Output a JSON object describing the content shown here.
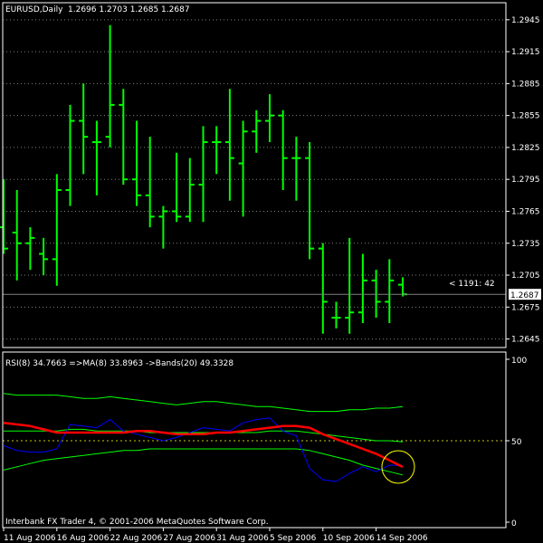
{
  "header": {
    "symbol": "EURUSD,Daily",
    "ohlc": "1.2696 1.2703 1.2685 1.2687"
  },
  "price_label": "1.2687",
  "order_label": "< 1191: 42",
  "indicator_header": "RSI(8) 34.7663   =>MA(8) 33.8963   ->Bands(20) 49.3328",
  "footer": "Interbank FX Trader 4, © 2001-2006 MetaQuotes Software Corp.",
  "colors": {
    "background": "#000000",
    "frame": "#FFFFFF",
    "grid": "#808080",
    "bars": "#00FF00",
    "rsi": "#0000FF",
    "ma": "#FF0000",
    "bands": "#00FF00",
    "level_line": "#C8C800",
    "highlight_circle": "#FFFF00",
    "price_label_bg": "#FFFFFF"
  },
  "chart_data": [
    {
      "type": "ohlc",
      "title": "EURUSD,Daily",
      "x_tick_labels": [
        "11 Aug 2006",
        "16 Aug 2006",
        "22 Aug 2006",
        "27 Aug 2006",
        "31 Aug 2006",
        "5 Sep 2006",
        "10 Sep 2006",
        "14 Sep 2006"
      ],
      "y_tick_labels": [
        "1.2945",
        "1.2915",
        "1.2885",
        "1.2855",
        "1.2825",
        "1.2795",
        "1.2765",
        "1.2735",
        "1.2705",
        "1.2675",
        "1.2645"
      ],
      "ylim": [
        1.2637,
        1.2961
      ],
      "current_price": 1.2687,
      "grid": true,
      "bars": [
        {
          "o": 1.275,
          "h": 1.2795,
          "l": 1.2725,
          "c": 1.273
        },
        {
          "o": 1.2745,
          "h": 1.2785,
          "l": 1.27,
          "c": 1.2735
        },
        {
          "o": 1.2735,
          "h": 1.275,
          "l": 1.271,
          "c": 1.274
        },
        {
          "o": 1.2725,
          "h": 1.274,
          "l": 1.2705,
          "c": 1.272
        },
        {
          "o": 1.272,
          "h": 1.28,
          "l": 1.2695,
          "c": 1.2785
        },
        {
          "o": 1.2785,
          "h": 1.2865,
          "l": 1.277,
          "c": 1.285
        },
        {
          "o": 1.285,
          "h": 1.2885,
          "l": 1.28,
          "c": 1.2835
        },
        {
          "o": 1.283,
          "h": 1.285,
          "l": 1.278,
          "c": 1.283
        },
        {
          "o": 1.2835,
          "h": 1.294,
          "l": 1.2825,
          "c": 1.2865
        },
        {
          "o": 1.2865,
          "h": 1.288,
          "l": 1.279,
          "c": 1.2795
        },
        {
          "o": 1.2795,
          "h": 1.285,
          "l": 1.277,
          "c": 1.278
        },
        {
          "o": 1.278,
          "h": 1.2835,
          "l": 1.275,
          "c": 1.276
        },
        {
          "o": 1.276,
          "h": 1.277,
          "l": 1.273,
          "c": 1.2765
        },
        {
          "o": 1.2765,
          "h": 1.282,
          "l": 1.2755,
          "c": 1.276
        },
        {
          "o": 1.276,
          "h": 1.2815,
          "l": 1.2755,
          "c": 1.279
        },
        {
          "o": 1.279,
          "h": 1.2845,
          "l": 1.2755,
          "c": 1.283
        },
        {
          "o": 1.283,
          "h": 1.2845,
          "l": 1.28,
          "c": 1.283
        },
        {
          "o": 1.283,
          "h": 1.288,
          "l": 1.2775,
          "c": 1.2815
        },
        {
          "o": 1.281,
          "h": 1.285,
          "l": 1.276,
          "c": 1.284
        },
        {
          "o": 1.284,
          "h": 1.286,
          "l": 1.282,
          "c": 1.285
        },
        {
          "o": 1.285,
          "h": 1.2875,
          "l": 1.283,
          "c": 1.2855
        },
        {
          "o": 1.2855,
          "h": 1.286,
          "l": 1.2785,
          "c": 1.2815
        },
        {
          "o": 1.2815,
          "h": 1.2835,
          "l": 1.2775,
          "c": 1.2815
        },
        {
          "o": 1.2815,
          "h": 1.283,
          "l": 1.272,
          "c": 1.273
        },
        {
          "o": 1.273,
          "h": 1.2735,
          "l": 1.265,
          "c": 1.268
        },
        {
          "o": 1.2665,
          "h": 1.268,
          "l": 1.2655,
          "c": 1.2665
        },
        {
          "o": 1.2665,
          "h": 1.274,
          "l": 1.265,
          "c": 1.267
        },
        {
          "o": 1.267,
          "h": 1.2725,
          "l": 1.266,
          "c": 1.27
        },
        {
          "o": 1.27,
          "h": 1.271,
          "l": 1.2665,
          "c": 1.268
        },
        {
          "o": 1.268,
          "h": 1.272,
          "l": 1.266,
          "c": 1.27
        },
        {
          "o": 1.2696,
          "h": 1.2703,
          "l": 1.2685,
          "c": 1.2687
        }
      ]
    },
    {
      "type": "line",
      "title": "RSI(8) 34.7663   =>MA(8) 33.8963   ->Bands(20) 49.3328",
      "ylim": [
        0,
        100
      ],
      "y_tick_labels": [
        "100",
        "50",
        "0"
      ],
      "level": 50,
      "series": [
        {
          "name": "RSI(8)",
          "values": [
            47,
            44,
            43,
            43,
            45,
            60,
            59,
            58,
            63,
            56,
            54,
            52,
            50,
            52,
            55,
            58,
            57,
            56,
            61,
            63,
            64,
            56,
            53,
            33,
            26,
            25,
            30,
            34,
            31,
            35,
            34.7663
          ]
        },
        {
          "name": "MA(8)",
          "values": [
            61,
            60,
            59,
            57,
            55,
            55,
            55,
            55,
            55,
            55,
            56,
            56,
            55,
            54,
            54,
            54,
            55,
            55,
            56,
            57,
            58,
            59,
            59,
            58,
            54,
            51,
            48,
            45,
            42,
            38,
            33.8963
          ]
        },
        {
          "name": "Upper Band",
          "values": [
            79,
            78,
            78,
            78,
            78,
            77,
            76,
            76,
            77,
            76,
            75,
            74,
            73,
            72,
            73,
            74,
            74,
            73,
            72,
            71,
            71,
            70,
            69,
            68,
            68,
            68,
            69,
            69,
            70,
            70,
            71
          ]
        },
        {
          "name": "Bands(20)",
          "values": [
            56,
            56,
            56,
            56,
            56,
            57,
            57,
            56,
            56,
            56,
            56,
            55,
            55,
            55,
            55,
            55,
            55,
            55,
            55,
            55,
            56,
            56,
            56,
            55,
            54,
            53,
            52,
            51,
            50,
            50,
            49.3328
          ]
        },
        {
          "name": "Lower Band",
          "values": [
            32,
            34,
            36,
            38,
            39,
            40,
            41,
            42,
            43,
            44,
            44,
            45,
            45,
            45,
            45,
            45,
            45,
            45,
            45,
            45,
            45,
            45,
            45,
            44,
            42,
            40,
            38,
            35,
            33,
            31,
            29
          ]
        }
      ]
    }
  ]
}
